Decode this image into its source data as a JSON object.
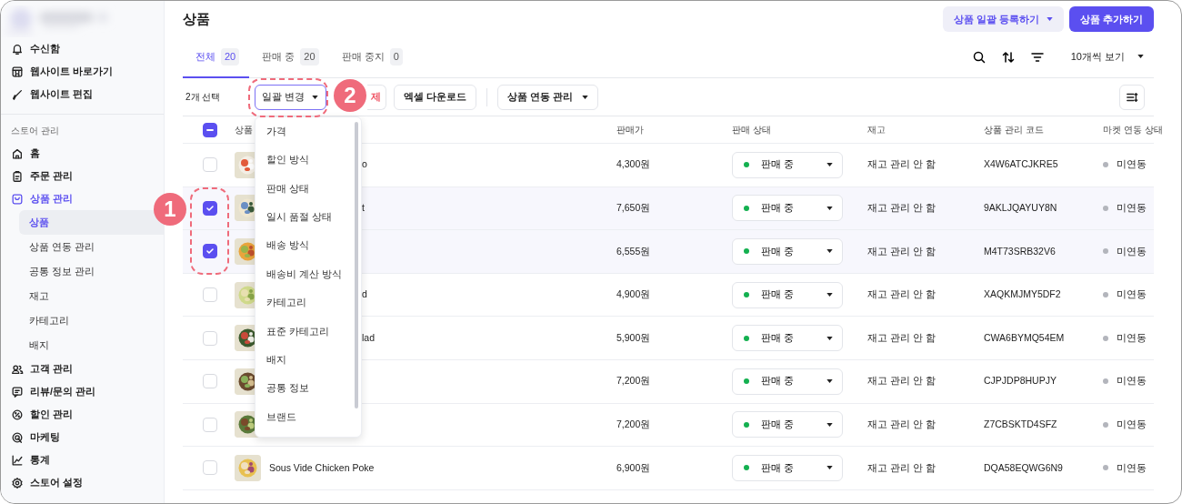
{
  "sidebar": {
    "top_items": [
      {
        "label": "수신함"
      },
      {
        "label": "웹사이트 바로가기"
      },
      {
        "label": "웹사이트 편집"
      }
    ],
    "section_label": "스토어 관리",
    "items": [
      {
        "label": "홈",
        "selected": false
      },
      {
        "label": "주문 관리",
        "selected": false
      },
      {
        "label": "상품 관리",
        "selected": true,
        "children": [
          {
            "label": "상품",
            "selected": true
          },
          {
            "label": "상품 연동 관리",
            "selected": false
          },
          {
            "label": "공통 정보 관리",
            "selected": false
          },
          {
            "label": "재고",
            "selected": false
          },
          {
            "label": "카테고리",
            "selected": false
          },
          {
            "label": "배지",
            "selected": false
          }
        ]
      },
      {
        "label": "고객 관리",
        "selected": false
      },
      {
        "label": "리뷰/문의 관리",
        "selected": false
      },
      {
        "label": "할인 관리",
        "selected": false
      },
      {
        "label": "마케팅",
        "selected": false
      },
      {
        "label": "통계",
        "selected": false
      },
      {
        "label": "스토어 설정",
        "selected": false
      }
    ]
  },
  "page_title": "상품",
  "header_buttons": [
    {
      "label": "상품 일괄 등록하기",
      "kind": "secondary"
    },
    {
      "label": "상품 추가하기",
      "kind": "primary"
    }
  ],
  "tabs": [
    {
      "label": "전체",
      "count": "20",
      "selected": true
    },
    {
      "label": "판매 중",
      "count": "20",
      "selected": false
    },
    {
      "label": "판매 중지",
      "count": "0",
      "selected": false
    }
  ],
  "page_size": "10개씩 보기",
  "toolbar": {
    "selection": "2개 선택",
    "buttons": [
      {
        "label": "일괄 변경",
        "kind": "dropdown",
        "focused": true
      },
      {
        "label": "제",
        "kind": "danger",
        "focused": false
      },
      {
        "label": "엑셀 다운로드",
        "kind": "plain",
        "focused": false
      },
      {
        "label": "상품 연동 관리",
        "kind": "dropdown",
        "focused": false
      }
    ]
  },
  "bulk_menu": {
    "open": true,
    "items": [
      "가격",
      "할인 방식",
      "판매 상태",
      "일시 품절 상태",
      "배송 방식",
      "배송비 계산 방식",
      "카테고리",
      "표준 카테고리",
      "배지",
      "공통 정보",
      "브랜드"
    ]
  },
  "table": {
    "header_checkbox": {
      "indeterminate": true
    },
    "columns": [
      "상품",
      "판매가",
      "판매 상태",
      "재고",
      "상품 관리 코드",
      "마켓 연동 상태"
    ],
    "rows": [
      {
        "selected": false,
        "name": "o",
        "price": "4,300원",
        "status": "판매 중",
        "stock": "재고 관리 안 함",
        "code": "X4W6ATCJKRE5",
        "market": "미연동"
      },
      {
        "selected": true,
        "name": "t",
        "price": "7,650원",
        "status": "판매 중",
        "stock": "재고 관리 안 함",
        "code": "9AKLJQAYUY8N",
        "market": "미연동"
      },
      {
        "selected": true,
        "price": "6,555원",
        "status": "판매 중",
        "stock": "재고 관리 안 함",
        "code": "M4T73SRB32V6",
        "market": "미연동"
      },
      {
        "selected": false,
        "name": "d",
        "price": "4,900원",
        "status": "판매 중",
        "stock": "재고 관리 안 함",
        "code": "XAQKMJMY5DF2",
        "market": "미연동"
      },
      {
        "selected": false,
        "name": "lad",
        "price": "5,900원",
        "status": "판매 중",
        "stock": "재고 관리 안 함",
        "code": "CWA6BYMQ54EM",
        "market": "미연동"
      },
      {
        "selected": false,
        "price": "7,200원",
        "status": "판매 중",
        "stock": "재고 관리 안 함",
        "code": "CJPJDP8HUPJY",
        "market": "미연동"
      },
      {
        "selected": false,
        "price": "7,200원",
        "status": "판매 중",
        "stock": "재고 관리 안 함",
        "code": "Z7CBSKTD4SFZ",
        "market": "미연동"
      },
      {
        "selected": false,
        "name": "Sous Vide Chicken Poke",
        "price": "6,900원",
        "status": "판매 중",
        "stock": "재고 관리 안 함",
        "code": "DQA58EQWG6N9",
        "market": "미연동"
      }
    ]
  },
  "annotations": [
    {
      "label": "1"
    },
    {
      "label": "2"
    }
  ]
}
